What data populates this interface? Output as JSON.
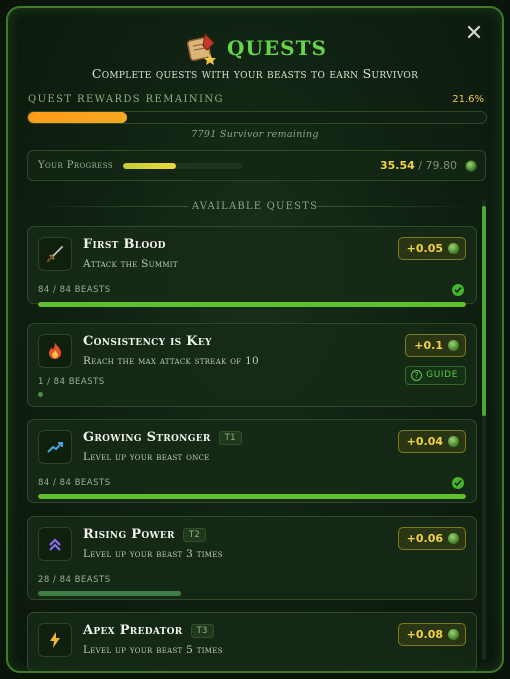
{
  "header": {
    "title": "QUESTS",
    "subtitle": "Complete quests with your beasts to earn Survivor",
    "close_icon": "close-icon",
    "title_icon": "scroll-quill-icon"
  },
  "rewards": {
    "label": "QUEST REWARDS REMAINING",
    "percent_text": "21.6%",
    "percent_value": 21.6,
    "remaining_text": "7791 Survivor remaining"
  },
  "progress": {
    "label": "Your Progress",
    "current": "35.54",
    "separator": "/",
    "max": "79.80",
    "fill_fraction": 0.445
  },
  "section_label": "AVAILABLE QUESTS",
  "quests": [
    {
      "title": "First Blood",
      "tier": "",
      "description": "Attack the Summit",
      "reward": "+0.05",
      "beasts": "84 / 84 BEASTS",
      "progress_fraction": 1.0,
      "completed": true,
      "icon": "sword-icon",
      "bar_color": "#5fbf2f"
    },
    {
      "title": "Consistency is Key",
      "tier": "",
      "description": "Reach the max attack streak of 10",
      "reward": "+0.1",
      "beasts": "1 / 84 BEASTS",
      "progress_fraction": 0.0,
      "completed": false,
      "guide_label": "GUIDE",
      "icon": "flame-icon",
      "bar_color": "#4d8f3e"
    },
    {
      "title": "Growing Stronger",
      "tier": "T1",
      "description": "Level up your beast once",
      "reward": "+0.04",
      "beasts": "84 / 84 BEASTS",
      "progress_fraction": 1.0,
      "completed": true,
      "icon": "trending-up-icon",
      "bar_color": "#5fbf2f"
    },
    {
      "title": "Rising Power",
      "tier": "T2",
      "description": "Level up your beast 3 times",
      "reward": "+0.06",
      "beasts": "28 / 84 BEASTS",
      "progress_fraction": 0.333,
      "completed": false,
      "icon": "double-chevron-up-icon",
      "bar_color": "#3f7f47"
    },
    {
      "title": "Apex Predator",
      "tier": "T3",
      "description": "Level up your beast 5 times",
      "reward": "+0.08",
      "beasts": "",
      "progress_fraction": 0,
      "completed": false,
      "icon": "lightning-icon",
      "bar_color": "#3f7f47"
    }
  ],
  "colors": {
    "accent": "#66d34a",
    "gold": "#f3d346",
    "orange": "#ff9a1a"
  }
}
